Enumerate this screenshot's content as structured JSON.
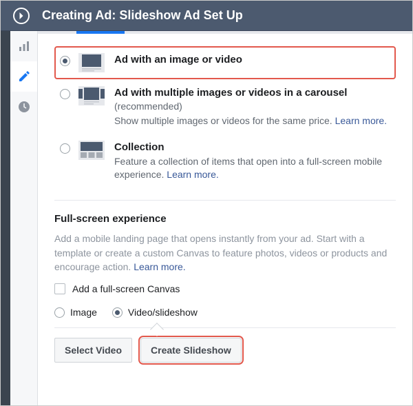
{
  "header": {
    "title": "Creating Ad: Slideshow Ad Set Up"
  },
  "formats": {
    "single": {
      "title": "Ad with an image or video"
    },
    "carousel": {
      "title": "Ad with multiple images or videos in a carousel",
      "rec": "(recommended)",
      "desc": "Show multiple images or videos for the same price. ",
      "learn": "Learn more."
    },
    "collection": {
      "title": "Collection",
      "desc": "Feature a collection of items that open into a full-screen mobile experience. ",
      "learn": "Learn more."
    }
  },
  "fullscreen": {
    "heading": "Full-screen experience",
    "desc": "Add a mobile landing page that opens instantly from your ad. Start with a template or create a custom Canvas to feature photos, videos or products and encourage action. ",
    "learn": "Learn more.",
    "checkbox_label": "Add a full-screen Canvas"
  },
  "media": {
    "image_label": "Image",
    "video_label": "Video/slideshow",
    "select_video": "Select Video",
    "create_slideshow": "Create Slideshow"
  }
}
